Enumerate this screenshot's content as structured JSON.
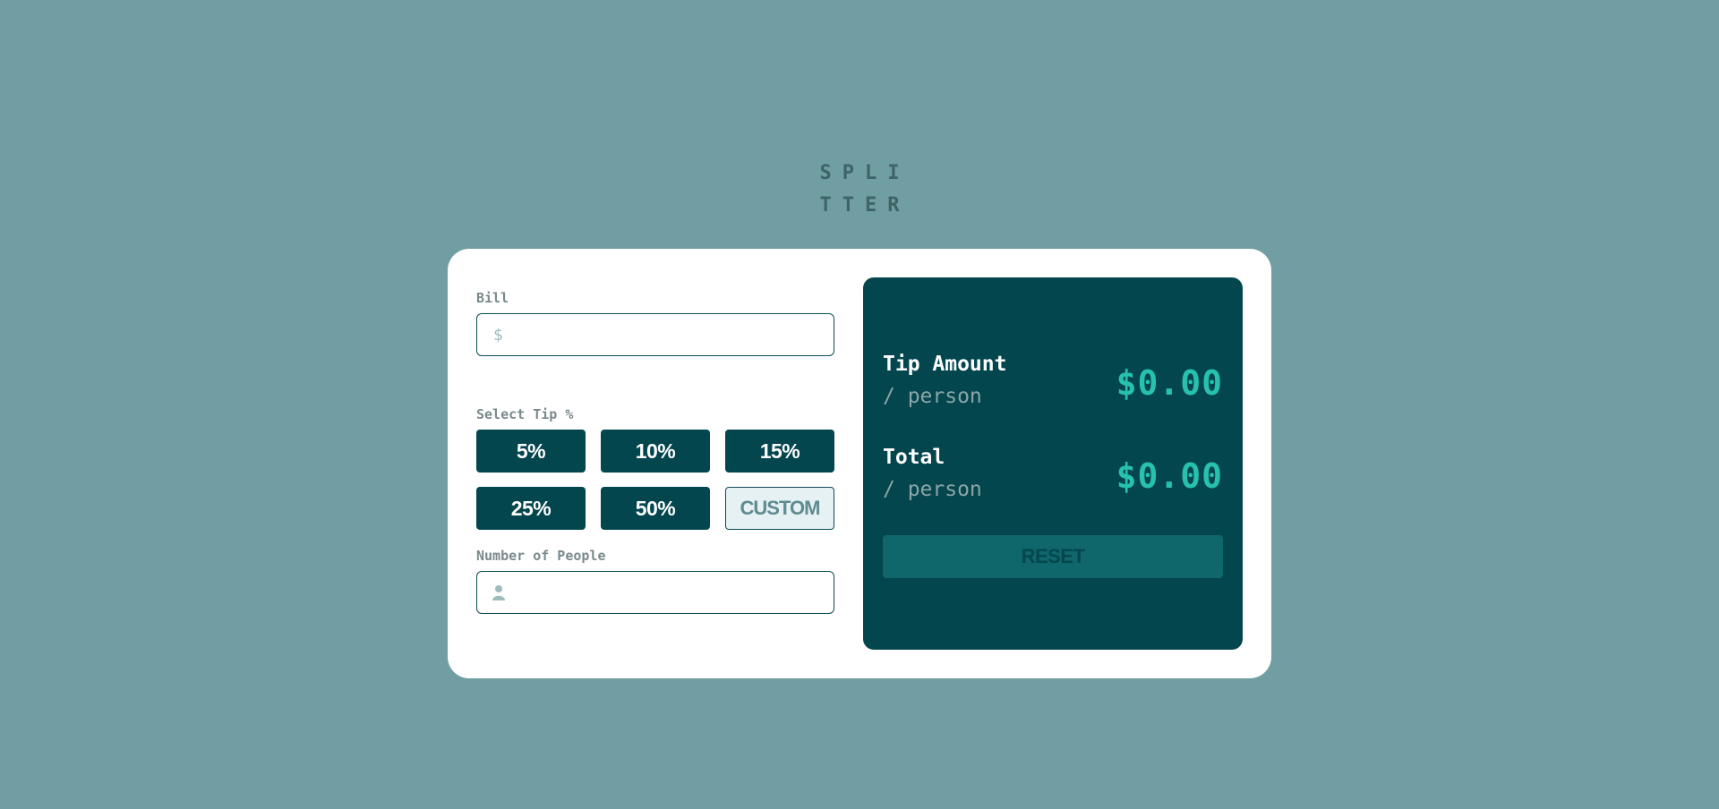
{
  "app": {
    "logo_line1": "SPLI",
    "logo_line2": "TTER"
  },
  "bill": {
    "label": "Bill",
    "prefix": "$",
    "value": "",
    "placeholder": ""
  },
  "tip": {
    "label": "Select Tip %",
    "options": [
      "5%",
      "10%",
      "15%",
      "25%",
      "50%"
    ],
    "custom_label": "CUSTOM"
  },
  "people": {
    "label": "Number of People",
    "value": "",
    "placeholder": "",
    "icon": "person-icon"
  },
  "results": {
    "tip_amount_label": "Tip Amount",
    "tip_amount_sub": "/ person",
    "tip_amount_value": "$0.00",
    "total_label": "Total",
    "total_sub": "/ person",
    "total_value": "$0.00",
    "reset_label": "RESET"
  },
  "colors": {
    "background": "#719ea2",
    "dark_accent": "#04464e",
    "value_accent": "#26c2ad",
    "reset_disabled": "#0f676b",
    "custom_bg": "#e5f1f2"
  }
}
